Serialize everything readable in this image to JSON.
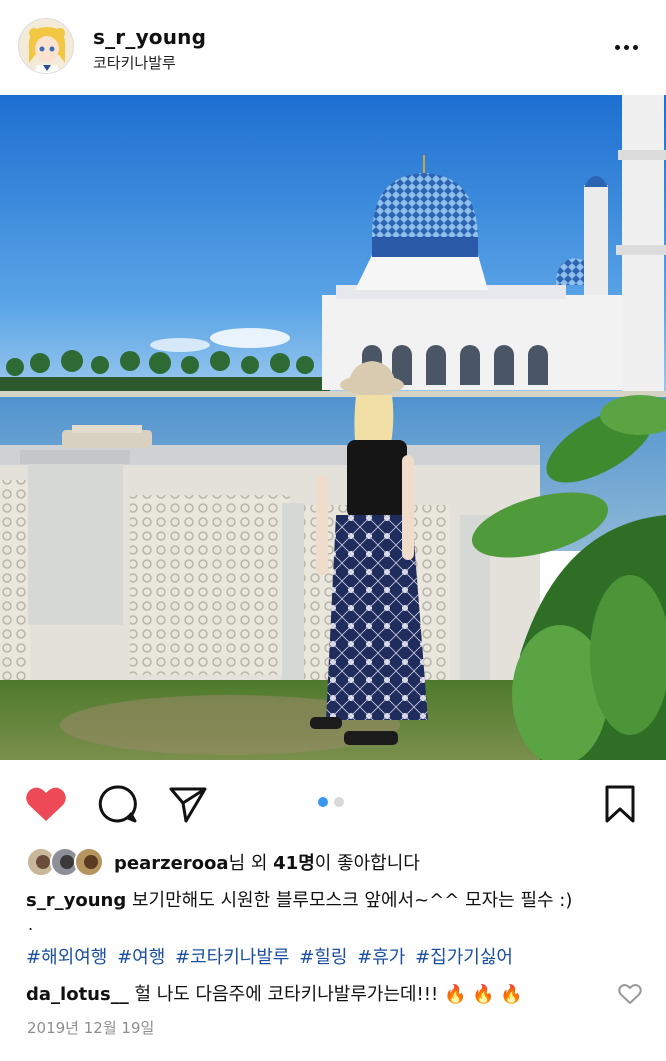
{
  "post": {
    "username": "s_r_young",
    "location": "코타키나발루"
  },
  "actions": {
    "like": "heart-filled-icon",
    "comment": "comment-icon",
    "share": "send-icon",
    "save": "bookmark-icon"
  },
  "carousel": {
    "total": 2,
    "active": 1
  },
  "likes": {
    "user": "pearzerooa",
    "text_mid": "님 외 ",
    "count": "41명",
    "text_end": "이 좋아합니다"
  },
  "caption": {
    "username": "s_r_young",
    "text": "보기만해도 시원한 블루모스크 앞에서~^^ 모자는 필수 :)",
    "dot": "."
  },
  "hashtags": [
    "#해외여행",
    "#여행",
    "#코타키나발루",
    "#힐링",
    "#휴가",
    "#집가기싫어"
  ],
  "comment": {
    "username": "da_lotus__",
    "text": "헐 나도 다음주에 코타키나발루가는데!!!",
    "emoji": "🔥 🔥 🔥"
  },
  "date": "2019년 12월 19일",
  "colors": {
    "like": "#ed4956",
    "hashtag": "#1c4fa0",
    "dot_active": "#3897f0"
  }
}
